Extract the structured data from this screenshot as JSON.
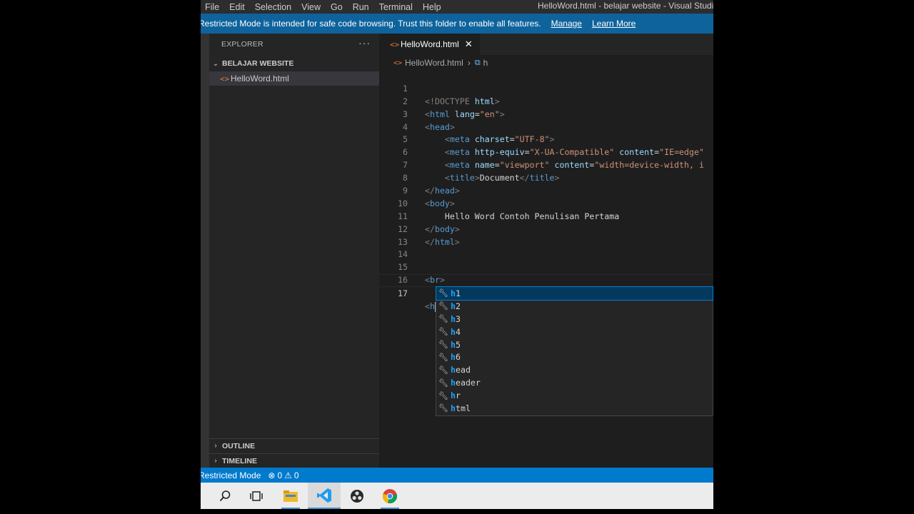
{
  "titlebar": {
    "menu": [
      "File",
      "Edit",
      "Selection",
      "View",
      "Go",
      "Run",
      "Terminal",
      "Help"
    ],
    "window_title": "HelloWord.html - belajar website - Visual Studio C"
  },
  "banner": {
    "message": "Restricted Mode is intended for safe code browsing. Trust this folder to enable all features.",
    "manage": "Manage",
    "learn_more": "Learn More"
  },
  "sidebar": {
    "title": "EXPLORER",
    "more": "···",
    "folder": "BELAJAR WEBSITE",
    "file": "HelloWord.html",
    "outline": "OUTLINE",
    "timeline": "TIMELINE"
  },
  "editor": {
    "tab_label": "HelloWord.html",
    "breadcrumb": {
      "file": "HelloWord.html",
      "symbol": "h"
    },
    "lines": [
      {
        "n": "1"
      },
      {
        "n": "2"
      },
      {
        "n": "3"
      },
      {
        "n": "4"
      },
      {
        "n": "5"
      },
      {
        "n": "6"
      },
      {
        "n": "7"
      },
      {
        "n": "8"
      },
      {
        "n": "9"
      },
      {
        "n": "10"
      },
      {
        "n": "11"
      },
      {
        "n": "12"
      },
      {
        "n": "13"
      },
      {
        "n": "14"
      },
      {
        "n": "15"
      },
      {
        "n": "16"
      },
      {
        "n": "17"
      }
    ],
    "code": {
      "doctype_open": "<!DOCTYPE",
      "doctype_html": "html",
      "doctype_close": ">",
      "html_tag": "html",
      "lang_attr": "lang",
      "lang_val": "\"en\"",
      "head_tag": "head",
      "meta_tag": "meta",
      "charset_attr": "charset",
      "charset_val": "\"UTF-8\"",
      "httpequiv_attr": "http-equiv",
      "httpequiv_val": "\"X-UA-Compatible\"",
      "content_attr": "content",
      "content_val1": "\"IE=edge\"",
      "name_attr": "name",
      "name_val": "\"viewport\"",
      "content_val2": "\"width=device-width, i",
      "title_tag": "title",
      "title_text": "Document",
      "body_tag": "body",
      "body_text": "Hello Word Contoh Penulisan Pertama",
      "br_tag": "br",
      "typed": "h"
    }
  },
  "suggestions": [
    {
      "match": "h",
      "rest": "1"
    },
    {
      "match": "h",
      "rest": "2"
    },
    {
      "match": "h",
      "rest": "3"
    },
    {
      "match": "h",
      "rest": "4"
    },
    {
      "match": "h",
      "rest": "5"
    },
    {
      "match": "h",
      "rest": "6"
    },
    {
      "match": "h",
      "rest": "ead"
    },
    {
      "match": "h",
      "rest": "eader"
    },
    {
      "match": "h",
      "rest": "r"
    },
    {
      "match": "h",
      "rest": "tml"
    }
  ],
  "statusbar": {
    "mode": "Restricted Mode",
    "errors": "0",
    "warnings": "0"
  },
  "taskbar": {
    "icons": [
      "search-icon",
      "task-view-icon",
      "file-explorer-icon",
      "vscode-icon",
      "obs-icon",
      "chrome-icon"
    ]
  },
  "colors": {
    "banner": "#0e639c",
    "statusbar": "#007acc",
    "tag": "#569cd6",
    "attr": "#9cdcfe",
    "string": "#ce9178"
  }
}
